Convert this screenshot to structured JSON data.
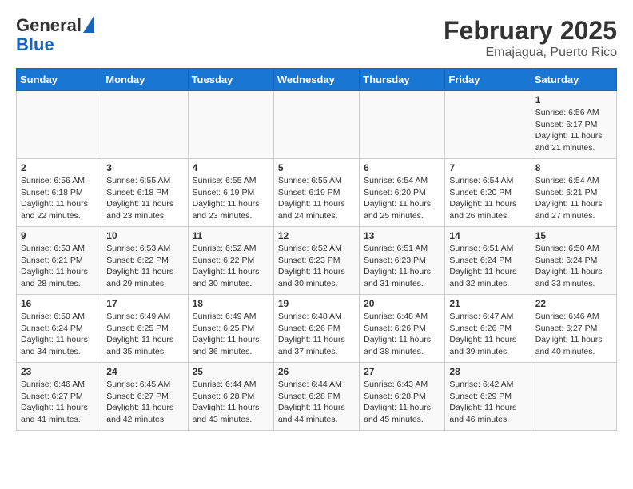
{
  "header": {
    "logo_line1": "General",
    "logo_line2": "Blue",
    "title": "February 2025",
    "subtitle": "Emajagua, Puerto Rico"
  },
  "days_of_week": [
    "Sunday",
    "Monday",
    "Tuesday",
    "Wednesday",
    "Thursday",
    "Friday",
    "Saturday"
  ],
  "weeks": [
    [
      {
        "day": "",
        "info": ""
      },
      {
        "day": "",
        "info": ""
      },
      {
        "day": "",
        "info": ""
      },
      {
        "day": "",
        "info": ""
      },
      {
        "day": "",
        "info": ""
      },
      {
        "day": "",
        "info": ""
      },
      {
        "day": "1",
        "info": "Sunrise: 6:56 AM\nSunset: 6:17 PM\nDaylight: 11 hours and 21 minutes."
      }
    ],
    [
      {
        "day": "2",
        "info": "Sunrise: 6:56 AM\nSunset: 6:18 PM\nDaylight: 11 hours and 22 minutes."
      },
      {
        "day": "3",
        "info": "Sunrise: 6:55 AM\nSunset: 6:18 PM\nDaylight: 11 hours and 23 minutes."
      },
      {
        "day": "4",
        "info": "Sunrise: 6:55 AM\nSunset: 6:19 PM\nDaylight: 11 hours and 23 minutes."
      },
      {
        "day": "5",
        "info": "Sunrise: 6:55 AM\nSunset: 6:19 PM\nDaylight: 11 hours and 24 minutes."
      },
      {
        "day": "6",
        "info": "Sunrise: 6:54 AM\nSunset: 6:20 PM\nDaylight: 11 hours and 25 minutes."
      },
      {
        "day": "7",
        "info": "Sunrise: 6:54 AM\nSunset: 6:20 PM\nDaylight: 11 hours and 26 minutes."
      },
      {
        "day": "8",
        "info": "Sunrise: 6:54 AM\nSunset: 6:21 PM\nDaylight: 11 hours and 27 minutes."
      }
    ],
    [
      {
        "day": "9",
        "info": "Sunrise: 6:53 AM\nSunset: 6:21 PM\nDaylight: 11 hours and 28 minutes."
      },
      {
        "day": "10",
        "info": "Sunrise: 6:53 AM\nSunset: 6:22 PM\nDaylight: 11 hours and 29 minutes."
      },
      {
        "day": "11",
        "info": "Sunrise: 6:52 AM\nSunset: 6:22 PM\nDaylight: 11 hours and 30 minutes."
      },
      {
        "day": "12",
        "info": "Sunrise: 6:52 AM\nSunset: 6:23 PM\nDaylight: 11 hours and 30 minutes."
      },
      {
        "day": "13",
        "info": "Sunrise: 6:51 AM\nSunset: 6:23 PM\nDaylight: 11 hours and 31 minutes."
      },
      {
        "day": "14",
        "info": "Sunrise: 6:51 AM\nSunset: 6:24 PM\nDaylight: 11 hours and 32 minutes."
      },
      {
        "day": "15",
        "info": "Sunrise: 6:50 AM\nSunset: 6:24 PM\nDaylight: 11 hours and 33 minutes."
      }
    ],
    [
      {
        "day": "16",
        "info": "Sunrise: 6:50 AM\nSunset: 6:24 PM\nDaylight: 11 hours and 34 minutes."
      },
      {
        "day": "17",
        "info": "Sunrise: 6:49 AM\nSunset: 6:25 PM\nDaylight: 11 hours and 35 minutes."
      },
      {
        "day": "18",
        "info": "Sunrise: 6:49 AM\nSunset: 6:25 PM\nDaylight: 11 hours and 36 minutes."
      },
      {
        "day": "19",
        "info": "Sunrise: 6:48 AM\nSunset: 6:26 PM\nDaylight: 11 hours and 37 minutes."
      },
      {
        "day": "20",
        "info": "Sunrise: 6:48 AM\nSunset: 6:26 PM\nDaylight: 11 hours and 38 minutes."
      },
      {
        "day": "21",
        "info": "Sunrise: 6:47 AM\nSunset: 6:26 PM\nDaylight: 11 hours and 39 minutes."
      },
      {
        "day": "22",
        "info": "Sunrise: 6:46 AM\nSunset: 6:27 PM\nDaylight: 11 hours and 40 minutes."
      }
    ],
    [
      {
        "day": "23",
        "info": "Sunrise: 6:46 AM\nSunset: 6:27 PM\nDaylight: 11 hours and 41 minutes."
      },
      {
        "day": "24",
        "info": "Sunrise: 6:45 AM\nSunset: 6:27 PM\nDaylight: 11 hours and 42 minutes."
      },
      {
        "day": "25",
        "info": "Sunrise: 6:44 AM\nSunset: 6:28 PM\nDaylight: 11 hours and 43 minutes."
      },
      {
        "day": "26",
        "info": "Sunrise: 6:44 AM\nSunset: 6:28 PM\nDaylight: 11 hours and 44 minutes."
      },
      {
        "day": "27",
        "info": "Sunrise: 6:43 AM\nSunset: 6:28 PM\nDaylight: 11 hours and 45 minutes."
      },
      {
        "day": "28",
        "info": "Sunrise: 6:42 AM\nSunset: 6:29 PM\nDaylight: 11 hours and 46 minutes."
      },
      {
        "day": "",
        "info": ""
      }
    ]
  ]
}
